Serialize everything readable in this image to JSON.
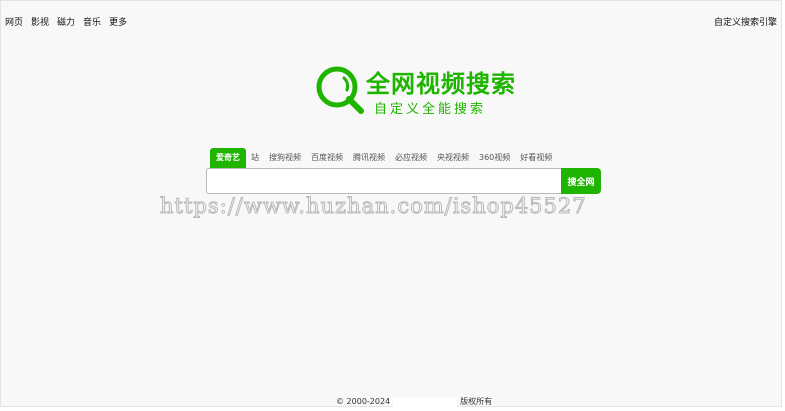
{
  "nav": {
    "items": [
      "网页",
      "影视",
      "磁力",
      "音乐",
      "更多"
    ],
    "custom_engine": "自定义搜索引擎"
  },
  "logo": {
    "title": "全网视频搜索",
    "subtitle": "自定义全能搜索",
    "icon": "search-magnifier-icon",
    "color": "#1eb400"
  },
  "tabs": [
    "爱奇艺",
    "站",
    "搜狗视频",
    "百度视频",
    "腾讯视频",
    "必应视频",
    "央视视频",
    "360视频",
    "好看视频"
  ],
  "search": {
    "value": "",
    "placeholder": "",
    "button_label": "搜全网"
  },
  "watermark": "https://www.huzhan.com/ishop45527",
  "footer": {
    "left": "© 2000-2024",
    "right": "版权所有"
  }
}
